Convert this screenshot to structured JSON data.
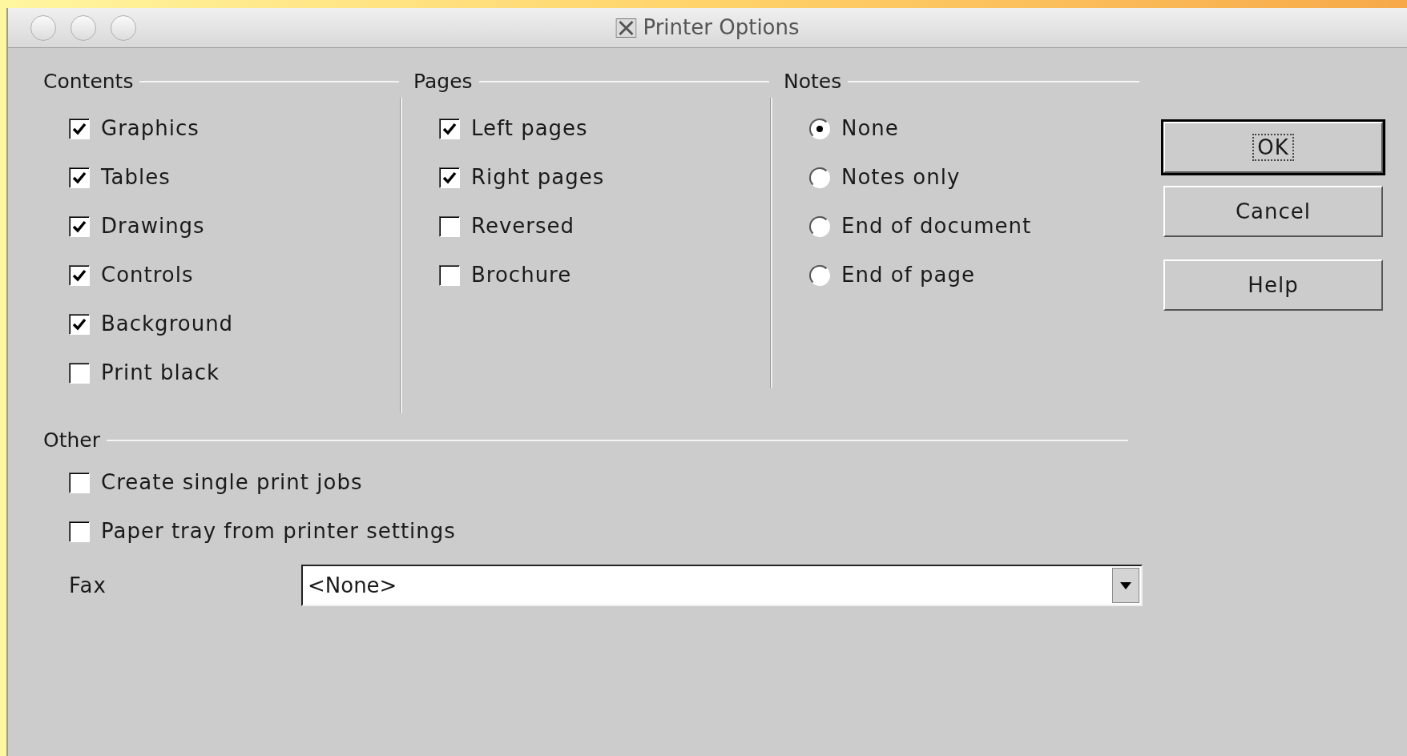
{
  "window": {
    "title": "Printer Options"
  },
  "groups": [
    {
      "title": "Contents",
      "kind": "checkbox",
      "items": [
        {
          "label": "Graphics",
          "checked": true
        },
        {
          "label": "Tables",
          "checked": true
        },
        {
          "label": "Drawings",
          "checked": true
        },
        {
          "label": "Controls",
          "checked": true
        },
        {
          "label": "Background",
          "checked": true
        },
        {
          "label": "Print black",
          "checked": false
        }
      ]
    },
    {
      "title": "Pages",
      "kind": "checkbox",
      "items": [
        {
          "label": "Left pages",
          "checked": true
        },
        {
          "label": "Right pages",
          "checked": true
        },
        {
          "label": "Reversed",
          "checked": false
        },
        {
          "label": "Brochure",
          "checked": false
        }
      ]
    },
    {
      "title": "Notes",
      "kind": "radio",
      "items": [
        {
          "label": "None",
          "selected": true
        },
        {
          "label": "Notes only",
          "selected": false
        },
        {
          "label": "End of document",
          "selected": false
        },
        {
          "label": "End of page",
          "selected": false
        }
      ]
    }
  ],
  "other": {
    "title": "Other",
    "items": [
      {
        "label": "Create single print jobs",
        "checked": false
      },
      {
        "label": "Paper tray from printer settings",
        "checked": false
      }
    ],
    "fax": {
      "label": "Fax",
      "value": "<None>"
    }
  },
  "buttons": [
    {
      "label": "OK",
      "default": true
    },
    {
      "label": "Cancel",
      "default": false
    },
    {
      "label": "Help",
      "default": false
    }
  ]
}
